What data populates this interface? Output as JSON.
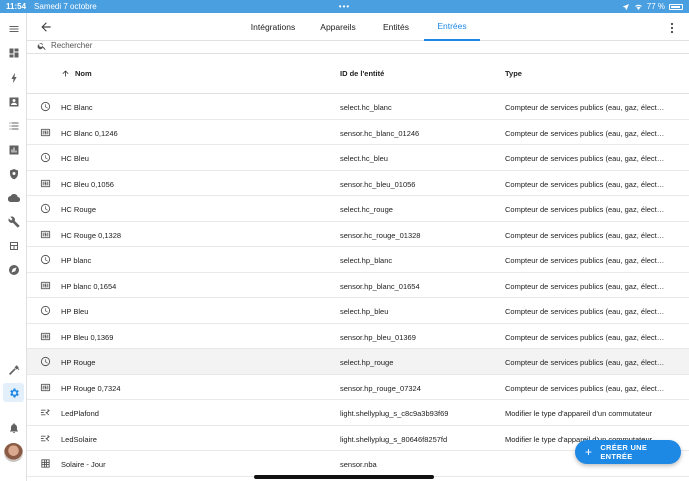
{
  "status_bar": {
    "time": "11:54",
    "date": "Samedi 7 octobre",
    "battery": "77 %",
    "dots": "•••"
  },
  "sidebar": {
    "items": [
      {
        "icon": "menu-icon"
      },
      {
        "icon": "dashboard-icon"
      },
      {
        "icon": "energy-icon"
      },
      {
        "icon": "map-icon"
      },
      {
        "icon": "logbook-icon"
      },
      {
        "icon": "history-icon"
      },
      {
        "icon": "shield-icon"
      },
      {
        "icon": "cloud-icon"
      },
      {
        "icon": "wrench-icon"
      },
      {
        "icon": "media-icon"
      },
      {
        "icon": "compass-icon"
      },
      {
        "icon": "hammer-icon"
      },
      {
        "icon": "gear-icon",
        "active": true
      },
      {
        "icon": "bell-icon"
      }
    ]
  },
  "tabs": [
    {
      "label": "Intégrations"
    },
    {
      "label": "Appareils"
    },
    {
      "label": "Entités"
    },
    {
      "label": "Entrées",
      "active": true
    }
  ],
  "search": {
    "placeholder": "Rechercher"
  },
  "table": {
    "headers": {
      "name": "Nom",
      "id": "ID de l'entité",
      "type": "Type"
    },
    "rows": [
      {
        "icon": "clock-icon",
        "name": "HC Blanc",
        "id": "select.hc_blanc",
        "type": "Compteur de services publics (eau, gaz, électr..."
      },
      {
        "icon": "counter-icon",
        "name": "HC Blanc 0,1246",
        "id": "sensor.hc_blanc_01246",
        "type": "Compteur de services publics (eau, gaz, électr..."
      },
      {
        "icon": "clock-icon",
        "name": "HC Bleu",
        "id": "select.hc_bleu",
        "type": "Compteur de services publics (eau, gaz, électr..."
      },
      {
        "icon": "counter-icon",
        "name": "HC Bleu 0,1056",
        "id": "sensor.hc_bleu_01056",
        "type": "Compteur de services publics (eau, gaz, électr..."
      },
      {
        "icon": "clock-icon",
        "name": "HC Rouge",
        "id": "select.hc_rouge",
        "type": "Compteur de services publics (eau, gaz, électr..."
      },
      {
        "icon": "counter-icon",
        "name": "HC Rouge 0,1328",
        "id": "sensor.hc_rouge_01328",
        "type": "Compteur de services publics (eau, gaz, électr..."
      },
      {
        "icon": "clock-icon",
        "name": "HP blanc",
        "id": "select.hp_blanc",
        "type": "Compteur de services publics (eau, gaz, électr..."
      },
      {
        "icon": "counter-icon",
        "name": "HP blanc 0,1654",
        "id": "sensor.hp_blanc_01654",
        "type": "Compteur de services publics (eau, gaz, électr..."
      },
      {
        "icon": "clock-icon",
        "name": "HP Bleu",
        "id": "select.hp_bleu",
        "type": "Compteur de services publics (eau, gaz, électr..."
      },
      {
        "icon": "counter-icon",
        "name": "HP Bleu 0,1369",
        "id": "sensor.hp_bleu_01369",
        "type": "Compteur de services publics (eau, gaz, électr..."
      },
      {
        "icon": "clock-icon",
        "name": "HP Rouge",
        "id": "select.hp_rouge",
        "type": "Compteur de services publics (eau, gaz, électr...",
        "hover": true
      },
      {
        "icon": "counter-icon",
        "name": "HP Rouge 0,7324",
        "id": "sensor.hp_rouge_07324",
        "type": "Compteur de services publics (eau, gaz, électr..."
      },
      {
        "icon": "switch-icon",
        "name": "LedPlafond",
        "id": "light.shellyplug_s_c8c9a3b93f69",
        "type": "Modifier le type d'appareil d'un commutateur"
      },
      {
        "icon": "switch-icon",
        "name": "LedSolaire",
        "id": "light.shellyplug_s_80646f8257fd",
        "type": "Modifier le type d'appareil d'un commutateur"
      },
      {
        "icon": "grid-icon",
        "name": "Solaire - Jour",
        "id": "sensor.nba",
        "type": ""
      }
    ]
  },
  "fab": {
    "label": "CRÉER UNE ENTRÉE"
  },
  "colors": {
    "accent": "#1e88e5",
    "status_bar": "#4a9fe0"
  }
}
